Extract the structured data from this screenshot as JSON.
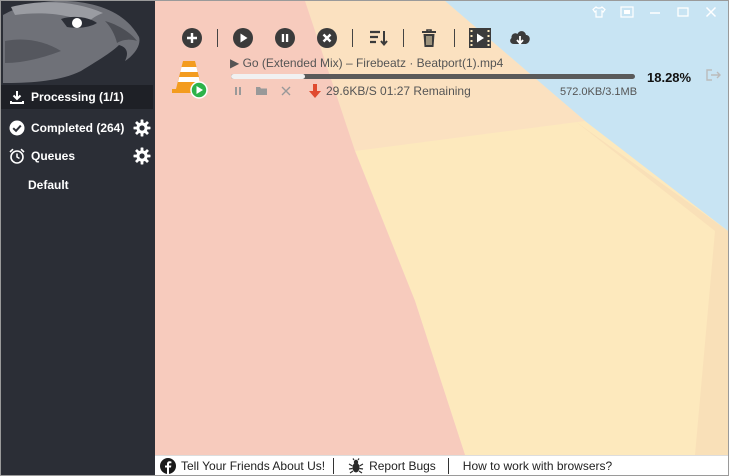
{
  "sidebar": {
    "items": [
      {
        "label": "Processing (1/1)",
        "icon": "download-icon"
      },
      {
        "label": "Completed (264)",
        "icon": "check-circle-icon"
      },
      {
        "label": "Queues",
        "icon": "alarm-clock-icon"
      },
      {
        "label": "Default",
        "icon": ""
      }
    ]
  },
  "toolbar": {
    "buttons": [
      "add-icon",
      "play-icon",
      "pause-icon",
      "stop-icon",
      "sort-icon",
      "trash-icon",
      "video-icon",
      "cloud-download-icon"
    ]
  },
  "download": {
    "file_name": "Go (Extended Mix) – Firebeatz · Beatport(1).mp4",
    "progress": 0.1828,
    "percent": "18.28%",
    "speed": "29.6KB/S 01:27 Remaining",
    "size": "572.0KB/3.1MB"
  },
  "footer": {
    "tell_friends": "Tell Your Friends About Us!",
    "report_bugs": "Report Bugs",
    "how_to": "How to work with browsers?"
  },
  "colors": {
    "sidebar_bg": "#2b2e36",
    "sidebar_active": "#1e2026",
    "accent_red": "#e04a2f",
    "play_green": "#2db34a"
  }
}
